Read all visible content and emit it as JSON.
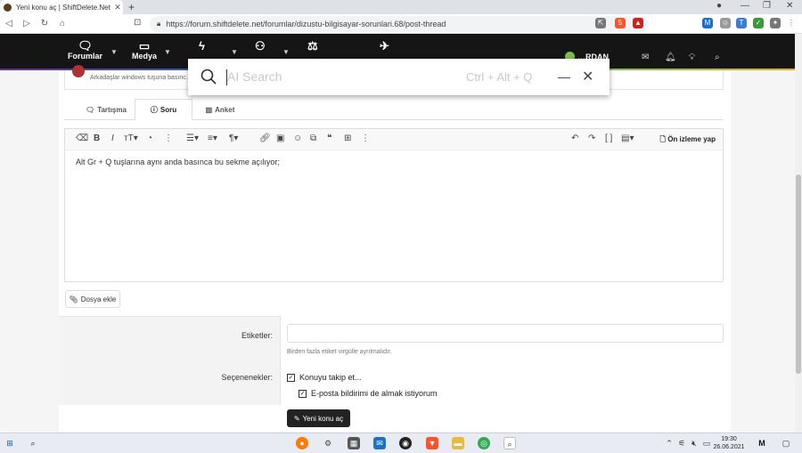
{
  "browser": {
    "tab_title": "Yeni konu aç | ShiftDelete.Net Fo…",
    "url": "https://forum.shiftdelete.net/forumlar/dizustu-bilgisayar-sorunlari.68/post-thread",
    "shield_badge": "5"
  },
  "site_nav": {
    "items": [
      {
        "label": "Forumlar"
      },
      {
        "label": "Medya"
      }
    ],
    "user_name": "…RDAN"
  },
  "preview_row": {
    "text": "Arkadaşlar windows tuşuna basınc…"
  },
  "form_tabs": [
    {
      "label": "Tartışma"
    },
    {
      "label": "Soru"
    },
    {
      "label": "Anket"
    }
  ],
  "editor": {
    "preview_label": "Ön izleme yap",
    "body_text": "Alt Gr + Q tuşlarına aynı anda basınca bu sekme açılıyor;"
  },
  "attach_label": "Dosya ekle",
  "form": {
    "tags_label": "Etiketler:",
    "tags_hint": "Birden fazla etiket virgülle ayrılmalıdır.",
    "options_label": "Seçenenekler:",
    "watch_label": "Konuyu takip et...",
    "email_label": "E-posta bildirimi de almak istiyorum",
    "submit_label": "Yeni konu aç"
  },
  "search_overlay": {
    "placeholder": "AI Search",
    "shortcut": "Ctrl + Alt + Q"
  },
  "taskbar": {
    "time": "19:30",
    "date": "26.06.2021"
  }
}
